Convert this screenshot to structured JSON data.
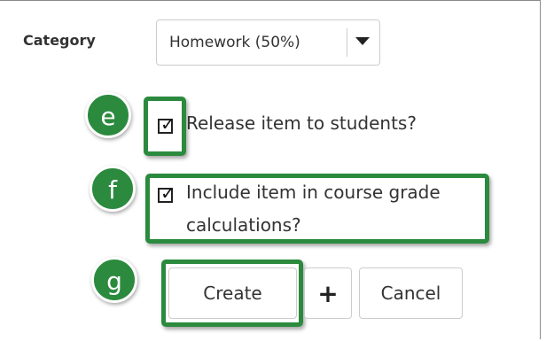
{
  "category": {
    "label": "Category",
    "selected": "Homework (50%)",
    "dropdown_icon": "caret-down-icon"
  },
  "badges": {
    "e": "e",
    "f": "f",
    "g": "g"
  },
  "options": [
    {
      "label": "Release item to students?",
      "checked": true
    },
    {
      "line1": "Include item in course grade",
      "line2": "calculations?",
      "checked": true
    }
  ],
  "buttons": {
    "create": "Create",
    "add": "+",
    "cancel": "Cancel"
  },
  "colors": {
    "highlight": "#2b8a3e",
    "badge": "#2b8a3e"
  }
}
